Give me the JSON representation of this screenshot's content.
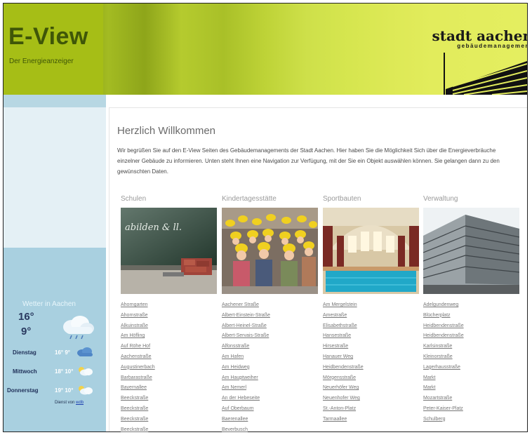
{
  "brand": {
    "title": "E-View",
    "subtitle": "Der Energieanzeiger"
  },
  "logo": {
    "title": "stadt aachen",
    "subtitle": "gebäudemanagement"
  },
  "page": {
    "welcome_title": "Herzlich Willkommen",
    "intro": "Wir begrüßen Sie auf den E-View Seiten des Gebäudemanagements der Stadt Aachen. Hier haben Sie die Möglichkeit Sich über die Energieverbräuche einzelner Gebäude zu informieren. Unten steht Ihnen eine Navigation zur Verfügung, mit der Sie ein Objekt auswählen können. Sie gelangen dann zu den gewünschten Daten."
  },
  "categories": [
    {
      "label": "Schulen",
      "photo": "classroom-chalkboard",
      "items": [
        "Ahorngarten",
        "Ahornstraße",
        "Alkuinstraße",
        "Am Höfling",
        "Auf Röhe Hof",
        "Aachenstraße",
        "Augustinerbach",
        "Barbarastraße",
        "Bayernallee",
        "Beeckstraße",
        "Beeckstraße",
        "Beeckstraße",
        "Beeckstraße"
      ]
    },
    {
      "label": "Kindertagesstätte",
      "photo": "kindergarten-children",
      "items": [
        "Aachener Straße",
        "Albert-Einstein-Straße",
        "Albert-Heinel-Straße",
        "Albert-Servais-Straße",
        "Alfonsstraße",
        "Am Hafen",
        "Am Heidweg",
        "Am Hauptweiher",
        "Am Nemerl",
        "An der Hebeseite",
        "Auf Oberbaum",
        "Baerenallee",
        "Beverbusch"
      ]
    },
    {
      "label": "Sportbauten",
      "photo": "indoor-swimming-pool",
      "items": [
        "Am Mergelstein",
        "Amestraße",
        "Elisabethstraße",
        "Hansestraße",
        "Hirsestraße",
        "Hanauer Weg",
        "Heidbendenstraße",
        "Mörgensstraße",
        "Neuerhöfer Weg",
        "Neuenhofer Weg",
        "St.-Anton-Platz",
        "Tarmaallee"
      ]
    },
    {
      "label": "Verwaltung",
      "photo": "office-building",
      "items": [
        "Adelgundenweg",
        "Blücherplatz",
        "Heidbendenstraße",
        "Heidbendenstraße",
        "Karlsinstraße",
        "Kleinorstraße",
        "Lagerhausstraße",
        "Markt",
        "Markt",
        "Mozartstraße",
        "Peter-Kaiser-Platz",
        "Schulberg"
      ]
    }
  ],
  "weather": {
    "title": "Wetter in Aachen",
    "today_high": "16°",
    "today_low": "9°",
    "today_icon": "rain-cloud-icon",
    "forecast": [
      {
        "day": "Dienstag",
        "temp": "16° 9°",
        "icon": "cloud-icon"
      },
      {
        "day": "Mittwoch",
        "temp": "18° 10°",
        "icon": "sun-cloud-icon"
      },
      {
        "day": "Donnerstag",
        "temp": "19° 10°",
        "icon": "sun-cloud-icon"
      }
    ],
    "credit_prefix": "Dienst von",
    "credit_link": "wdb"
  },
  "colors": {
    "header_green": "#a6be16",
    "brand_text": "#3f5608",
    "sidebar_blue": "#a9d0e0"
  }
}
